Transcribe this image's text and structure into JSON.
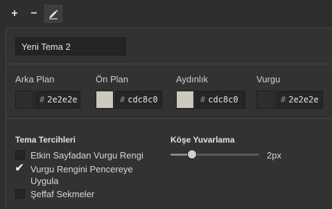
{
  "toolbar": {
    "add_label": "+",
    "remove_label": "−",
    "edit_icon": "pencil-icon"
  },
  "theme_name": "Yeni Tema 2",
  "colors": [
    {
      "label": "Arka Plan",
      "value": "2e2e2e",
      "swatch": "#2e2e2e"
    },
    {
      "label": "Ön Plan",
      "value": "cdc8c0",
      "swatch": "#cdc8c0"
    },
    {
      "label": "Aydınlık",
      "value": "cdc8c0",
      "swatch": "#cdc8c0"
    },
    {
      "label": "Vurgu",
      "value": "2e2e2e",
      "swatch": "#2e2e2e"
    }
  ],
  "hash_symbol": "#",
  "preferences": {
    "title": "Tema Tercihleri",
    "options": [
      {
        "label": "Etkin Sayfadan Vurgu Rengi",
        "checked": false
      },
      {
        "label": "Vurgu Rengini Pencereye Uygula",
        "checked": true
      },
      {
        "label": "Şeffaf Sekmeler",
        "checked": false
      }
    ]
  },
  "corner_rounding": {
    "title": "Köşe Yuvarlama",
    "value_label": "2px",
    "fraction": 0.24
  }
}
